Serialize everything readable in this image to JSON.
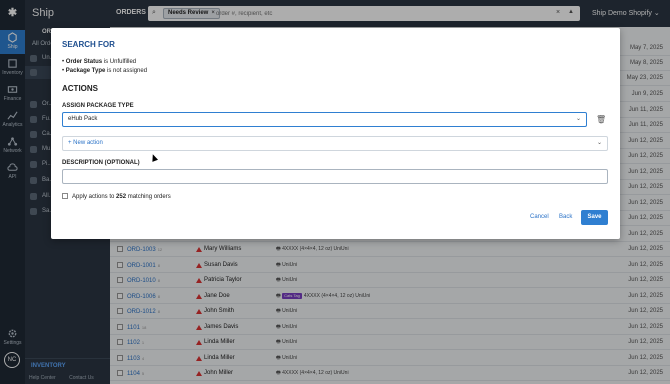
{
  "rail": {
    "items": [
      {
        "label": "Ship",
        "icon": "ship-icon",
        "active": true
      },
      {
        "label": "Inventory",
        "icon": "inventory-icon"
      },
      {
        "label": "Finance",
        "icon": "finance-icon"
      },
      {
        "label": "Analytics",
        "icon": "analytics-icon"
      },
      {
        "label": "Network",
        "icon": "network-icon"
      },
      {
        "label": "API",
        "icon": "api-icon"
      },
      {
        "label": "Settings",
        "icon": "gear-icon"
      }
    ],
    "avatar": "NC"
  },
  "sidebar": {
    "title": "Ship",
    "items": [
      {
        "label": "ORDERS"
      },
      {
        "label": "All Orders"
      },
      {
        "label": "Un..."
      },
      {
        "label": ""
      },
      {
        "label": "Or..."
      },
      {
        "label": "Fu..."
      },
      {
        "label": "Ca..."
      },
      {
        "label": "Mu..."
      },
      {
        "label": "Pi..."
      },
      {
        "label": "Ba..."
      },
      {
        "label": "All..."
      },
      {
        "label": "Sa..."
      }
    ],
    "inventory": "INVENTORY",
    "help_center": "Help Center",
    "contact_us": "Contact Us"
  },
  "topbar": {
    "orders_label": "ORDERS",
    "filter_chip": "Needs Review",
    "search_placeholder": "order #, recipient, etc",
    "store": "Ship Demo Shopify"
  },
  "table": {
    "rows": [
      {
        "id": "ORD-1003",
        "qty": "12",
        "name": "Mary Williams",
        "print": "4XXXX (4×4×4",
        "print_tail": ", 12 oz)  UniUni",
        "tag": "",
        "date": "Jun 12, 2025"
      },
      {
        "id": "ORD-1001",
        "qty": "8",
        "name": "Susan Davis",
        "print": "UniUni",
        "print_tail": "",
        "tag": "",
        "date": "Jun 12, 2025"
      },
      {
        "id": "ORD-1010",
        "qty": "8",
        "name": "Patricia Taylor",
        "print": "UniUni",
        "print_tail": "",
        "tag": "",
        "date": "Jun 12, 2025"
      },
      {
        "id": "ORD-1006",
        "qty": "8",
        "name": "Jane Doe",
        "print": "4XXXX (4×4×4",
        "print_tail": ", 12 oz)  UniUni",
        "tag": "Cats Tag",
        "date": "Jun 12, 2025"
      },
      {
        "id": "ORD-1012",
        "qty": "8",
        "name": "John Smith",
        "print": "UniUni",
        "print_tail": "",
        "tag": "",
        "date": "Jun 12, 2025"
      },
      {
        "id": "1101",
        "qty": "18",
        "name": "James Davis",
        "print": "UniUni",
        "print_tail": "",
        "tag": "",
        "date": "Jun 12, 2025"
      },
      {
        "id": "1102",
        "qty": "1",
        "name": "Linda Miller",
        "print": "UniUni",
        "print_tail": "",
        "tag": "",
        "date": "Jun 12, 2025"
      },
      {
        "id": "1103",
        "qty": "4",
        "name": "Linda Miller",
        "print": "UniUni",
        "print_tail": "",
        "tag": "",
        "date": "Jun 12, 2025"
      },
      {
        "id": "1104",
        "qty": "5",
        "name": "John Miller",
        "print": "4XXXX (4×4×4",
        "print_tail": ", 12 oz)  UniUni",
        "tag": "",
        "date": "Jun 12, 2025"
      }
    ],
    "dates_above": [
      "May 7, 2025",
      "May 8, 2025",
      "May 23, 2025",
      "Jun 9, 2025",
      "Jun 11, 2025",
      "Jun 11, 2025",
      "Jun 12, 2025",
      "Jun 12, 2025",
      "Jun 12, 2025",
      "Jun 12, 2025",
      "Jun 12, 2025",
      "Jun 12, 2025",
      "Jun 12, 2025"
    ]
  },
  "modal": {
    "search_for": "SEARCH FOR",
    "criteria": [
      {
        "field": "Order Status",
        "text": " is Unfulfilled"
      },
      {
        "field": "Package Type",
        "text": " is not assigned"
      }
    ],
    "actions_heading": "ACTIONS",
    "assign_label": "ASSIGN PACKAGE TYPE",
    "package_value": "eHub Pack",
    "new_action": "+ New action",
    "description_label": "DESCRIPTION (OPTIONAL)",
    "apply_prefix": "Apply actions to ",
    "apply_count": "252",
    "apply_suffix": " matching orders",
    "cancel": "Cancel",
    "back": "Back",
    "save": "Save"
  }
}
